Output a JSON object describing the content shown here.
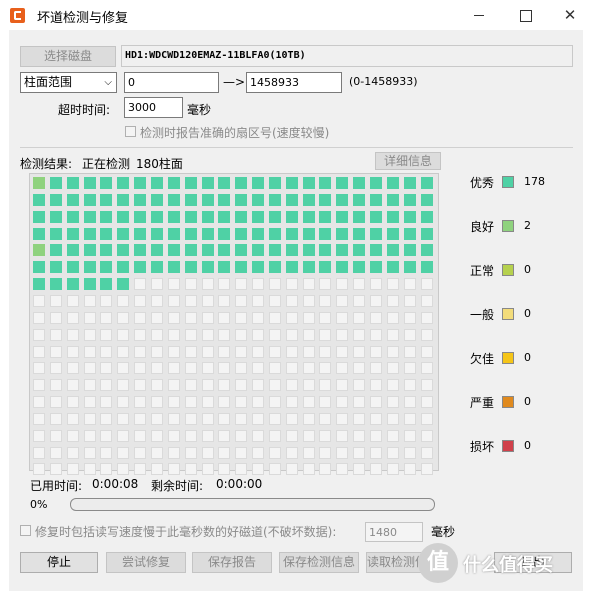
{
  "window": {
    "title": "坏道检测与修复"
  },
  "disk": {
    "select_label": "选择磁盘",
    "name": "HD1:WDCWD120EMAZ-11BLFA0(10TB)"
  },
  "range": {
    "mode": "柱面范围",
    "start": "0",
    "arrow": "—>",
    "end": "1458933",
    "hint": "(0-1458933)"
  },
  "timeout": {
    "label": "超时时间:",
    "value": "3000",
    "unit": "毫秒"
  },
  "report_slow": {
    "label": "检测时报告准确的扇区号(速度较慢)"
  },
  "result": {
    "label": "检测结果:",
    "status": "正在检测",
    "count_text": "180柱面",
    "detail_button": "详细信息"
  },
  "grid": {
    "columns": 24,
    "rows": 18,
    "cells_shown": [
      "good",
      "excellent",
      "excellent",
      "excellent",
      "excellent",
      "excellent",
      "excellent",
      "excellent",
      "excellent",
      "excellent",
      "excellent",
      "excellent",
      "excellent",
      "excellent",
      "excellent",
      "excellent",
      "excellent",
      "excellent",
      "excellent",
      "excellent",
      "excellent",
      "excellent",
      "excellent",
      "excellent",
      "excellent",
      "excellent",
      "excellent",
      "excellent",
      "excellent",
      "excellent",
      "excellent",
      "excellent",
      "excellent",
      "excellent",
      "excellent",
      "excellent",
      "excellent",
      "excellent",
      "excellent",
      "excellent",
      "excellent",
      "excellent",
      "excellent",
      "excellent",
      "excellent",
      "excellent",
      "excellent",
      "excellent",
      "excellent",
      "excellent",
      "excellent",
      "excellent",
      "excellent",
      "excellent",
      "excellent",
      "excellent",
      "excellent",
      "excellent",
      "excellent",
      "excellent",
      "excellent",
      "excellent",
      "excellent",
      "excellent",
      "excellent",
      "excellent",
      "excellent",
      "excellent",
      "excellent",
      "excellent",
      "excellent",
      "excellent",
      "excellent",
      "excellent",
      "excellent",
      "excellent",
      "excellent",
      "excellent",
      "excellent",
      "excellent",
      "excellent",
      "excellent",
      "excellent",
      "excellent",
      "excellent",
      "excellent",
      "excellent",
      "excellent",
      "excellent",
      "excellent",
      "excellent",
      "excellent",
      "excellent",
      "excellent",
      "excellent",
      "excellent",
      "good",
      "excellent",
      "excellent",
      "excellent",
      "excellent",
      "excellent",
      "excellent",
      "excellent",
      "excellent",
      "excellent",
      "excellent",
      "excellent",
      "excellent",
      "excellent",
      "excellent",
      "excellent",
      "excellent",
      "excellent",
      "excellent",
      "excellent",
      "excellent",
      "excellent",
      "excellent",
      "excellent",
      "excellent",
      "excellent",
      "excellent",
      "excellent",
      "excellent",
      "excellent",
      "excellent",
      "excellent",
      "excellent",
      "excellent",
      "excellent",
      "excellent",
      "excellent",
      "excellent",
      "excellent",
      "excellent",
      "excellent",
      "excellent",
      "excellent",
      "excellent",
      "excellent",
      "excellent",
      "excellent",
      "excellent",
      "excellent",
      "excellent",
      "excellent",
      "excellent",
      "excellent",
      "excellent"
    ],
    "colors": {
      "excellent": "#4fd1a5",
      "good": "#8fd27e",
      "empty": "#f4f4f4"
    }
  },
  "legend": [
    {
      "label": "优秀",
      "color": "#4fd1a5",
      "count": "178"
    },
    {
      "label": "良好",
      "color": "#8fd27e",
      "count": "2"
    },
    {
      "label": "正常",
      "color": "#b6d14e",
      "count": "0"
    },
    {
      "label": "一般",
      "color": "#f3dc7a",
      "count": "0"
    },
    {
      "label": "欠佳",
      "color": "#f5c518",
      "count": "0"
    },
    {
      "label": "严重",
      "color": "#e08a1e",
      "count": "0"
    },
    {
      "label": "损坏",
      "color": "#d0404a",
      "count": "0"
    }
  ],
  "time": {
    "elapsed_label": "已用时间:",
    "elapsed": "0:00:08",
    "remaining_label": "剩余时间:",
    "remaining": "0:00:00",
    "percent": "0%",
    "progress": 0
  },
  "repair_option": {
    "label": "修复时包括读写速度慢于此毫秒数的好磁道(不破坏数据):",
    "value": "1480",
    "unit": "毫秒"
  },
  "buttons": {
    "stop": "停止",
    "try_repair": "尝试修复",
    "save_report": "保存报告",
    "save_info": "保存检测信息",
    "load_info": "读取检测信",
    "exit": "退出"
  },
  "watermark": {
    "text": "什么值得买",
    "logo": "值"
  }
}
